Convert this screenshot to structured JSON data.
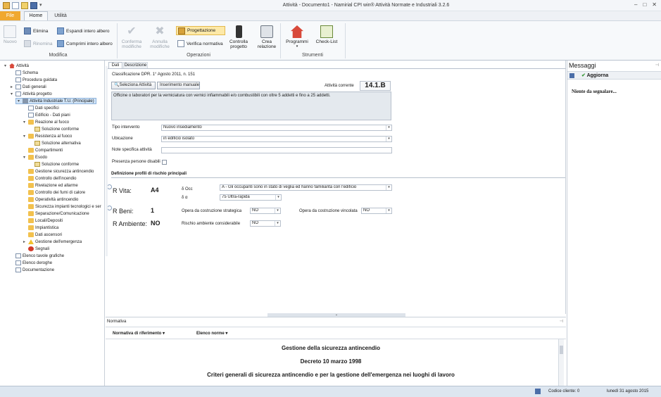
{
  "window": {
    "title": "Attività - Documento1 - Namirial CPI win® Attività Normate e Industriali 3.2.6"
  },
  "tabs": [
    "File",
    "Home",
    "Utilità"
  ],
  "ribbon": {
    "modifica": {
      "label": "Modifica",
      "nuovo": "Nuovo",
      "elimina": "Elimina",
      "rinomina": "Rinomina",
      "espandi": "Espandi intero albero",
      "comprimi": "Comprimi intero albero"
    },
    "operazioni": {
      "label": "Operazioni",
      "conferma": [
        "Conferma",
        "modifiche"
      ],
      "annulla": [
        "Annulla",
        "modifiche"
      ],
      "progettazione": "Progettazione",
      "verifica": "Verifica normativa",
      "controlla": [
        "Controlla",
        "progetto"
      ],
      "crea": [
        "Crea",
        "relazione"
      ]
    },
    "strumenti": {
      "label": "Strumenti",
      "programmi": "Programmi",
      "checklist": "Check-List"
    }
  },
  "tree": [
    {
      "label": "Attività",
      "level": 0,
      "toggle": "▾",
      "icon": "house-icon"
    },
    {
      "label": "Schema",
      "level": 1,
      "toggle": "",
      "icon": "doc-icon"
    },
    {
      "label": "Procedura guidata",
      "level": 1,
      "toggle": "",
      "icon": "doc-icon"
    },
    {
      "label": "Dati generali",
      "level": 1,
      "toggle": "▸",
      "icon": "doc-icon"
    },
    {
      "label": "Attività progetto",
      "level": 1,
      "toggle": "▾",
      "icon": "doc-icon"
    },
    {
      "label": "Attività Industriale T.U. (Principale)",
      "level": 2,
      "toggle": "▾",
      "icon": "factory-icon",
      "selected": true
    },
    {
      "label": "Dati specifici",
      "level": 3,
      "toggle": "",
      "icon": "doc-icon"
    },
    {
      "label": "Edificio - Dati piani",
      "level": 3,
      "toggle": "",
      "icon": "doc-icon"
    },
    {
      "label": "Reazione al fuoco",
      "level": 3,
      "toggle": "▾",
      "icon": "folder-icon"
    },
    {
      "label": "Soluzione conforme",
      "level": 4,
      "toggle": "",
      "icon": "pencil-icon"
    },
    {
      "label": "Resistenza al fuoco",
      "level": 3,
      "toggle": "▾",
      "icon": "folder-icon"
    },
    {
      "label": "Soluzione alternativa",
      "level": 4,
      "toggle": "",
      "icon": "pencil-icon"
    },
    {
      "label": "Compartimenti",
      "level": 3,
      "toggle": "",
      "icon": "folder-icon"
    },
    {
      "label": "Esodo",
      "level": 3,
      "toggle": "▾",
      "icon": "folder-icon"
    },
    {
      "label": "Soluzione conforme",
      "level": 4,
      "toggle": "",
      "icon": "pencil-icon"
    },
    {
      "label": "Gestione sicurezza antincendio",
      "level": 3,
      "toggle": "",
      "icon": "folder-icon"
    },
    {
      "label": "Controllo dell'incendio",
      "level": 3,
      "toggle": "",
      "icon": "folder-icon"
    },
    {
      "label": "Rivelazione ed allarme",
      "level": 3,
      "toggle": "",
      "icon": "folder-icon"
    },
    {
      "label": "Controllo dei fumi di calore",
      "level": 3,
      "toggle": "",
      "icon": "folder-icon"
    },
    {
      "label": "Operatività antincendio",
      "level": 3,
      "toggle": "",
      "icon": "folder-icon"
    },
    {
      "label": "Sicurezza impianti tecnologici e ser",
      "level": 3,
      "toggle": "",
      "icon": "folder-icon"
    },
    {
      "label": "Separazione/Comunicazione",
      "level": 3,
      "toggle": "",
      "icon": "folder-icon"
    },
    {
      "label": "Locali/Depositi",
      "level": 3,
      "toggle": "",
      "icon": "folder-icon"
    },
    {
      "label": "Impiantistica",
      "level": 3,
      "toggle": "",
      "icon": "folder-icon"
    },
    {
      "label": "Dati ascensori",
      "level": 3,
      "toggle": "",
      "icon": "folder-icon"
    },
    {
      "label": "Gestione dell'emergenza",
      "level": 3,
      "toggle": "▸",
      "icon": "warning-icon"
    },
    {
      "label": "Segnali",
      "level": 3,
      "toggle": "",
      "icon": "stop-sign-icon"
    },
    {
      "label": "Elenco tavole grafiche",
      "level": 1,
      "toggle": "",
      "icon": "doc-icon"
    },
    {
      "label": "Elenco deroghe",
      "level": 1,
      "toggle": "",
      "icon": "doc-icon"
    },
    {
      "label": "Documentazione",
      "level": 1,
      "toggle": "",
      "icon": "doc-icon"
    }
  ],
  "main": {
    "tabs": [
      "Dati",
      "Descrizione"
    ],
    "classificazione": "Classificazione DPR. 1° Agosto 2011, n. 151",
    "btn_seleziona": "Seleziona Attività",
    "btn_inserimento": "Inserimento manuale",
    "attivita_corrente_label": "Attività corrente",
    "attivita_corrente": "14.1.B",
    "descrizione": "Officine o laboratori per la verniciatura con vernici infiammabili e/o combustibili con oltre 5 addetti e fino a 25 addetti.",
    "tipo_intervento": {
      "label": "Tipo intervento",
      "value": "Nuovo insediamento"
    },
    "ubicazione": {
      "label": "Ubicazione",
      "value": "in edificio isolato"
    },
    "note": {
      "label": "Note specifica attività",
      "value": ""
    },
    "presenza": {
      "label": "Presenza persone disabili"
    },
    "definizione": "Definizione  profili di rischio principali",
    "rvita": {
      "label": "R Vita:",
      "value": "A4",
      "docc_label": "δ Occ",
      "docc_value": "A - Gli occupanti sono in stato di veglia ed hanno familiarità con l'edificio",
      "da_label": "δ α",
      "da_value": "75 Ultra-rapida"
    },
    "rbeni": {
      "label": "R Beni:",
      "value": "1",
      "strategica_label": "Opera da costruzione strategica",
      "strategica_value": "NO",
      "vincolata_label": "Opera da costruzione vincolata",
      "vincolata_value": "NO"
    },
    "rambiente": {
      "label": "R Ambiente:",
      "value": "NO",
      "rischio_label": "Rischio ambiente considerabile",
      "rischio_value": "NO"
    }
  },
  "messaggi": {
    "title": "Messaggi",
    "aggiorna": "Aggiorna",
    "text": "Niente da segnalare..."
  },
  "normativa": {
    "title": "Normativa",
    "col1": "Normativa di riferimento",
    "col2": "Elenco norme",
    "lines": [
      "Gestione della sicurezza antincendio",
      "Decreto 10 marzo 1998",
      "Criteri generali di sicurezza antincendio e per la gestione dell'emergenza nei luoghi di lavoro"
    ]
  },
  "status": {
    "codice": "Codice cliente: 0",
    "date": "lunedì 31 agosto 2015"
  },
  "colors": {
    "accent_file": "#f0a830",
    "ribbon_bg": "#f7f9fb",
    "selected": "#cfe3f7"
  }
}
